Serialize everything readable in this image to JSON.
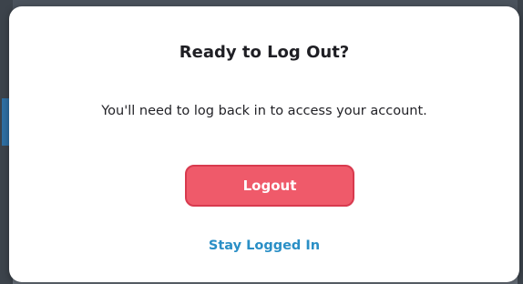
{
  "dialog": {
    "title": "Ready to Log Out?",
    "message": "You'll need to log back in to access your account.",
    "primary_button_label": "Logout",
    "secondary_link_label": "Stay Logged In"
  },
  "colors": {
    "primary_button": "#ef5a6a",
    "primary_button_border": "#d83a4e",
    "link": "#2a8fc6",
    "title_text": "#1f1f24"
  }
}
